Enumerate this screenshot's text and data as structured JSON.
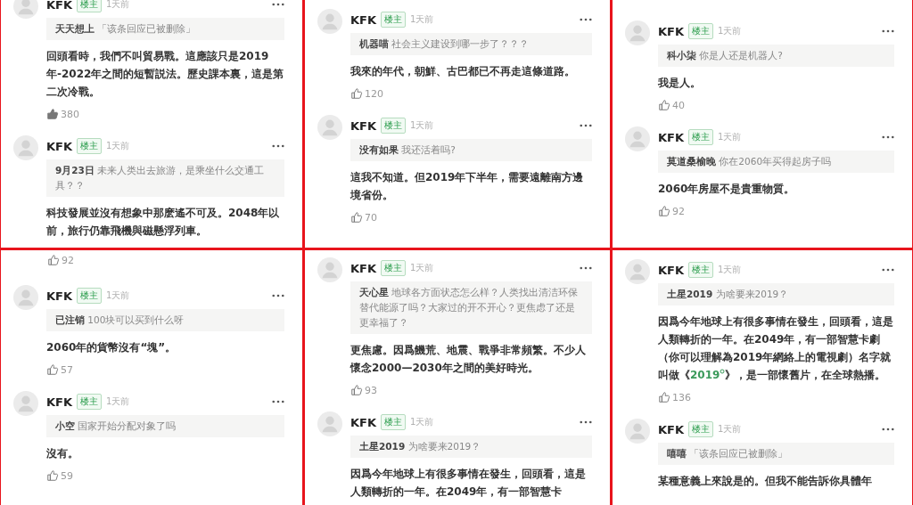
{
  "panels": [
    {
      "items": [
        {
          "kind": "comment",
          "author": "KFK",
          "badge": "楼主",
          "time": "1天前",
          "quote": {
            "user": "天天想上",
            "text": "「该条回应已被删除」"
          },
          "body": "回頭看時，我們不叫貿易戰。這應該只是2019年-2022年之間的短暫説法。歷史課本裏，這是第二次冷戰。",
          "likes": "380",
          "liked": true
        },
        {
          "kind": "comment",
          "author": "KFK",
          "badge": "楼主",
          "time": "1天前",
          "quote": {
            "user": "9月23日",
            "text": "未来人类出去旅游，是乘坐什么交通工具？？"
          },
          "body": "科技發展並沒有想象中那麽遙不可及。2048年以前，旅行仍靠飛機與磁懸浮列車。"
        }
      ]
    },
    {
      "items": [
        {
          "kind": "comment",
          "author": "KFK",
          "badge": "楼主",
          "time": "1天前",
          "quote": {
            "user": "机器喵",
            "text": "社会主义建设到哪一步了？？？"
          },
          "body": "我來的年代，朝鮮、古巴都已不再走這條道路。",
          "likes": "120",
          "liked": false
        },
        {
          "kind": "comment",
          "author": "KFK",
          "badge": "楼主",
          "time": "1天前",
          "quote": {
            "user": "没有如果",
            "text": "我还活着吗?"
          },
          "body": "這我不知道。但2019年下半年，需要遠離南方邊境省份。",
          "likes": "70",
          "liked": false
        }
      ]
    },
    {
      "items": [
        {
          "kind": "comment",
          "author": "KFK",
          "badge": "楼主",
          "time": "1天前",
          "quote": {
            "user": "科小柒",
            "text": "你是人还是机器人?"
          },
          "body": "我是人。",
          "likes": "40",
          "liked": false
        },
        {
          "kind": "comment",
          "author": "KFK",
          "badge": "楼主",
          "time": "1天前",
          "quote": {
            "user": "莫道桑榆晚",
            "text": "你在2060年买得起房子吗"
          },
          "body": "2060年房屋不是貴重物質。",
          "likes": "92",
          "liked": false
        }
      ]
    },
    {
      "items": [
        {
          "kind": "likes",
          "likes": "92",
          "liked": false
        },
        {
          "kind": "comment",
          "author": "KFK",
          "badge": "楼主",
          "time": "1天前",
          "quote": {
            "user": "已注销",
            "text": "100块可以买到什么呀"
          },
          "body": "2060年的貨幣沒有“塊”。",
          "likes": "57",
          "liked": false
        },
        {
          "kind": "comment",
          "author": "KFK",
          "badge": "楼主",
          "time": "1天前",
          "quote": {
            "user": "小空",
            "text": "国家开始分配对象了吗"
          },
          "body": "沒有。",
          "likes": "59",
          "liked": false
        }
      ]
    },
    {
      "items": [
        {
          "kind": "comment",
          "author": "KFK",
          "badge": "楼主",
          "time": "1天前",
          "quote": {
            "user": "天心星",
            "text": "地球各方面状态怎么样？人类找出清洁环保替代能源了吗？大家过的开不开心？更焦虑了还是更幸福了？"
          },
          "body": "更焦慮。因爲饑荒、地震、戰爭非常頻繁。不少人懷念2000—2030年之間的美好時光。",
          "likes": "93",
          "liked": false
        },
        {
          "kind": "comment",
          "author": "KFK",
          "badge": "楼主",
          "time": "1天前",
          "quote": {
            "user": "土星2019",
            "text": "为啥要来2019？"
          },
          "body": "因爲今年地球上有很多事情在發生，回頭看，這是人類轉折的一年。在2049年，有一部智慧卡"
        }
      ]
    },
    {
      "items": [
        {
          "kind": "comment",
          "author": "KFK",
          "badge": "楼主",
          "time": "1天前",
          "quote": {
            "user": "土星2019",
            "text": "为啥要来2019？"
          },
          "body_parts": [
            {
              "kind": "plain",
              "text": "因爲今年地球上有很多事情在發生，回頭看，這是人類轉折的一年。在2049年，有一部智慧卡劇（你可以理解為2019年網絡上的電視劇）名字就叫做《"
            },
            {
              "kind": "link",
              "text": "2019"
            },
            {
              "kind": "plain",
              "text": "》，是一部懷舊片，在全球熱播。"
            }
          ],
          "likes": "136",
          "liked": false
        },
        {
          "kind": "comment",
          "author": "KFK",
          "badge": "楼主",
          "time": "1天前",
          "quote": {
            "user": "嘻嘻",
            "text": "「该条回应已被删除」"
          },
          "body": "某種意義上來說是的。但我不能告訴你具體年"
        }
      ]
    }
  ]
}
